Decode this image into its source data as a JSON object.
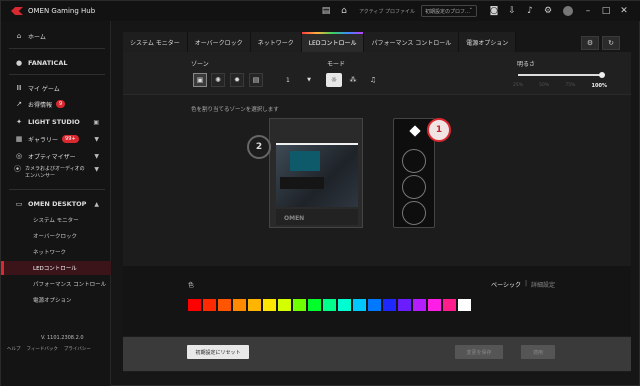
{
  "app": {
    "title": "OMEN Gaming Hub"
  },
  "titlebar": {
    "profile_label": "アクティブ プロファイル",
    "profile_value": "初期設定のプロフ…",
    "icons": [
      "news-icon",
      "home-icon",
      "gamepad-icon",
      "download-icon",
      "bell-icon",
      "gear-icon",
      "user-icon",
      "minimize-icon",
      "maximize-icon",
      "close-icon"
    ]
  },
  "sidebar": {
    "home": "ホーム",
    "fanatical": "FANATICAL",
    "my_game": "マイ ゲーム",
    "deals": "お得情報",
    "deals_badge": "9",
    "light_studio": "LIGHT STUDIO",
    "gallery": "ギャラリー",
    "gallery_badge": "99+",
    "optimizer": "オプティマイザー",
    "camera": "カメラおよびオーディオのエンハンサー",
    "omen_desktop": "OMEN DESKTOP",
    "sub": [
      "システム モニター",
      "オーバークロック",
      "ネットワーク",
      "LEDコントロール",
      "パフォーマンス コントロール",
      "電源オプション"
    ],
    "version": "V. 1101.2308.2.0",
    "footer": [
      "ヘルプ",
      "フィードバック",
      "プライバシー"
    ]
  },
  "tabs": [
    "システム モニター",
    "オーバークロック",
    "ネットワーク",
    "LEDコントロール",
    "パフォーマンス コントロール",
    "電源オプション"
  ],
  "controls": {
    "zone_label": "ゾーン",
    "zone_count": "1",
    "mode_label": "モード",
    "brightness_label": "明るさ",
    "brightness_ticks": [
      "25%",
      "50%",
      "75%",
      "100%"
    ],
    "brightness_value": 1.0
  },
  "canvas": {
    "hint": "色を割り当てるゾーンを選択します",
    "marker1": "1",
    "marker2": "2",
    "case_logo": "OMEN"
  },
  "colors": {
    "label": "色",
    "mode_basic": "ベーシック",
    "mode_sep": "|",
    "mode_advanced": "詳細設定",
    "swatches": [
      "#ff0000",
      "#ff2a00",
      "#ff5500",
      "#ff8a00",
      "#ffb400",
      "#ffe600",
      "#d4ff00",
      "#6eff00",
      "#00ff2a",
      "#00ff8a",
      "#00ffd0",
      "#00c8ff",
      "#0078ff",
      "#1e28ff",
      "#6a1eff",
      "#b41eff",
      "#ff1ee6",
      "#ff1e8c",
      "#ffffff"
    ]
  },
  "footer_buttons": {
    "reset": "初期設定にリセット",
    "save": "変更を保存",
    "apply": "適用"
  }
}
